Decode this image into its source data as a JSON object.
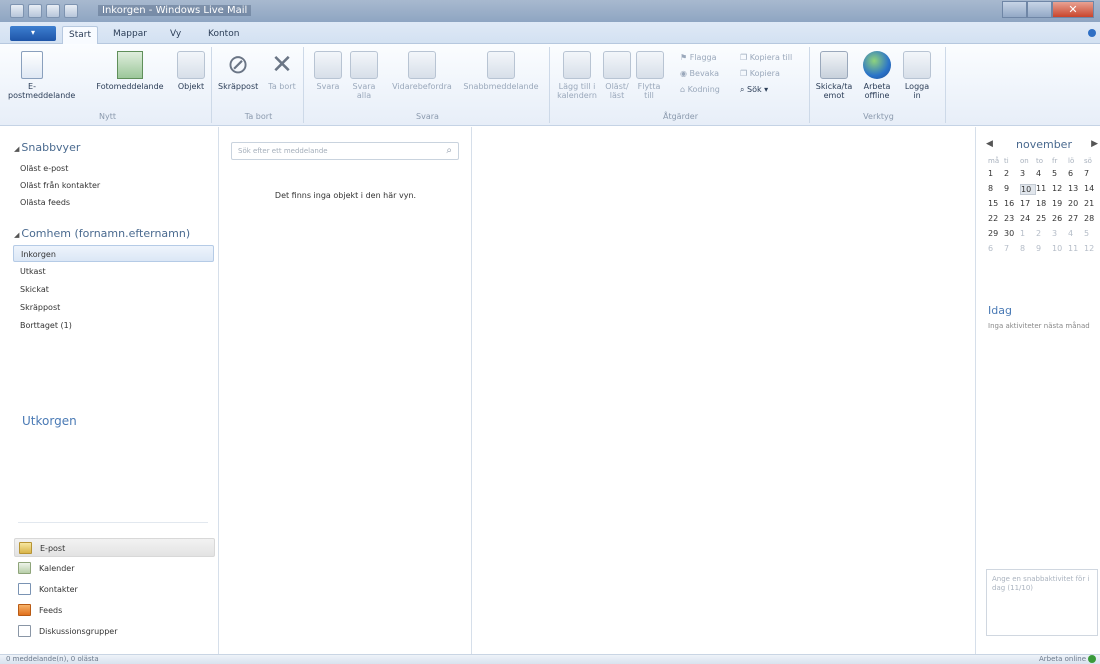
{
  "window": {
    "title": "Inkorgen - Windows Live Mail",
    "close_glyph": "✕"
  },
  "ribbon_tabs": [
    "Start",
    "Mappar",
    "Vy",
    "Konton"
  ],
  "ribbon": {
    "nytt": {
      "label": "Nytt",
      "email": "E-postmeddelande",
      "photo": "Fotomeddelande",
      "items": "Objekt"
    },
    "ta_bort": {
      "label": "Ta bort",
      "junk": "Skräppost",
      "delete": "Ta bort"
    },
    "svara": {
      "label": "Svara",
      "reply": "Svara",
      "reply_all": "Svara alla",
      "forward": "Vidarebefordra",
      "im": "Snabbmeddelande"
    },
    "atgarder": {
      "label": "Åtgärder",
      "add_calendar": "Lägg till i kalendern",
      "unread": "Oläst/ läst",
      "move": "Flytta till",
      "flag": "Flagga",
      "encoding": "Kodning",
      "watch": "Bevaka",
      "copy_to": "Kopiera till",
      "copy": "Kopiera",
      "find": "Sök"
    },
    "verktyg": {
      "label": "Verktyg",
      "send_receive": "Skicka/ta emot",
      "offline": "Arbeta offline",
      "signin": "Logga in"
    }
  },
  "left_pane": {
    "quick_views_header": "Snabbvyer",
    "quick_views": [
      "Oläst e-post",
      "Oläst från kontakter",
      "Olästa feeds"
    ],
    "account_header": "Comhem (fornamn.efternamn)",
    "folders": [
      "Inkorgen",
      "Utkast",
      "Skickat",
      "Skräppost",
      "Borttaget (1)"
    ],
    "outbox": "Utkorgen",
    "nav": [
      "E-post",
      "Kalender",
      "Kontakter",
      "Feeds",
      "Diskussionsgrupper"
    ]
  },
  "message_list": {
    "search_placeholder": "Sök efter ett meddelande",
    "search_icon": "⌕",
    "empty_text": "Det finns inga objekt i den här vyn."
  },
  "calendar": {
    "month": "november",
    "prev": "◀",
    "next": "▶",
    "dow": [
      "må",
      "ti",
      "on",
      "to",
      "fr",
      "lö",
      "sö"
    ],
    "weeks": [
      [
        "1",
        "2",
        "3",
        "4",
        "5",
        "6",
        "7"
      ],
      [
        "8",
        "9",
        "10",
        "11",
        "12",
        "13",
        "14"
      ],
      [
        "15",
        "16",
        "17",
        "18",
        "19",
        "20",
        "21"
      ],
      [
        "22",
        "23",
        "24",
        "25",
        "26",
        "27",
        "28"
      ],
      [
        "29",
        "30",
        "1",
        "2",
        "3",
        "4",
        "5"
      ],
      [
        "6",
        "7",
        "8",
        "9",
        "10",
        "11",
        "12"
      ]
    ],
    "today": "10",
    "today_header": "Idag",
    "no_activities": "Inga aktiviteter nästa månad",
    "quick_event_placeholder": "Ange en snabbaktivitet för i dag (11/10)"
  },
  "status_bar": {
    "left": "0 meddelande(n), 0 olästa",
    "right": "Arbeta online"
  }
}
